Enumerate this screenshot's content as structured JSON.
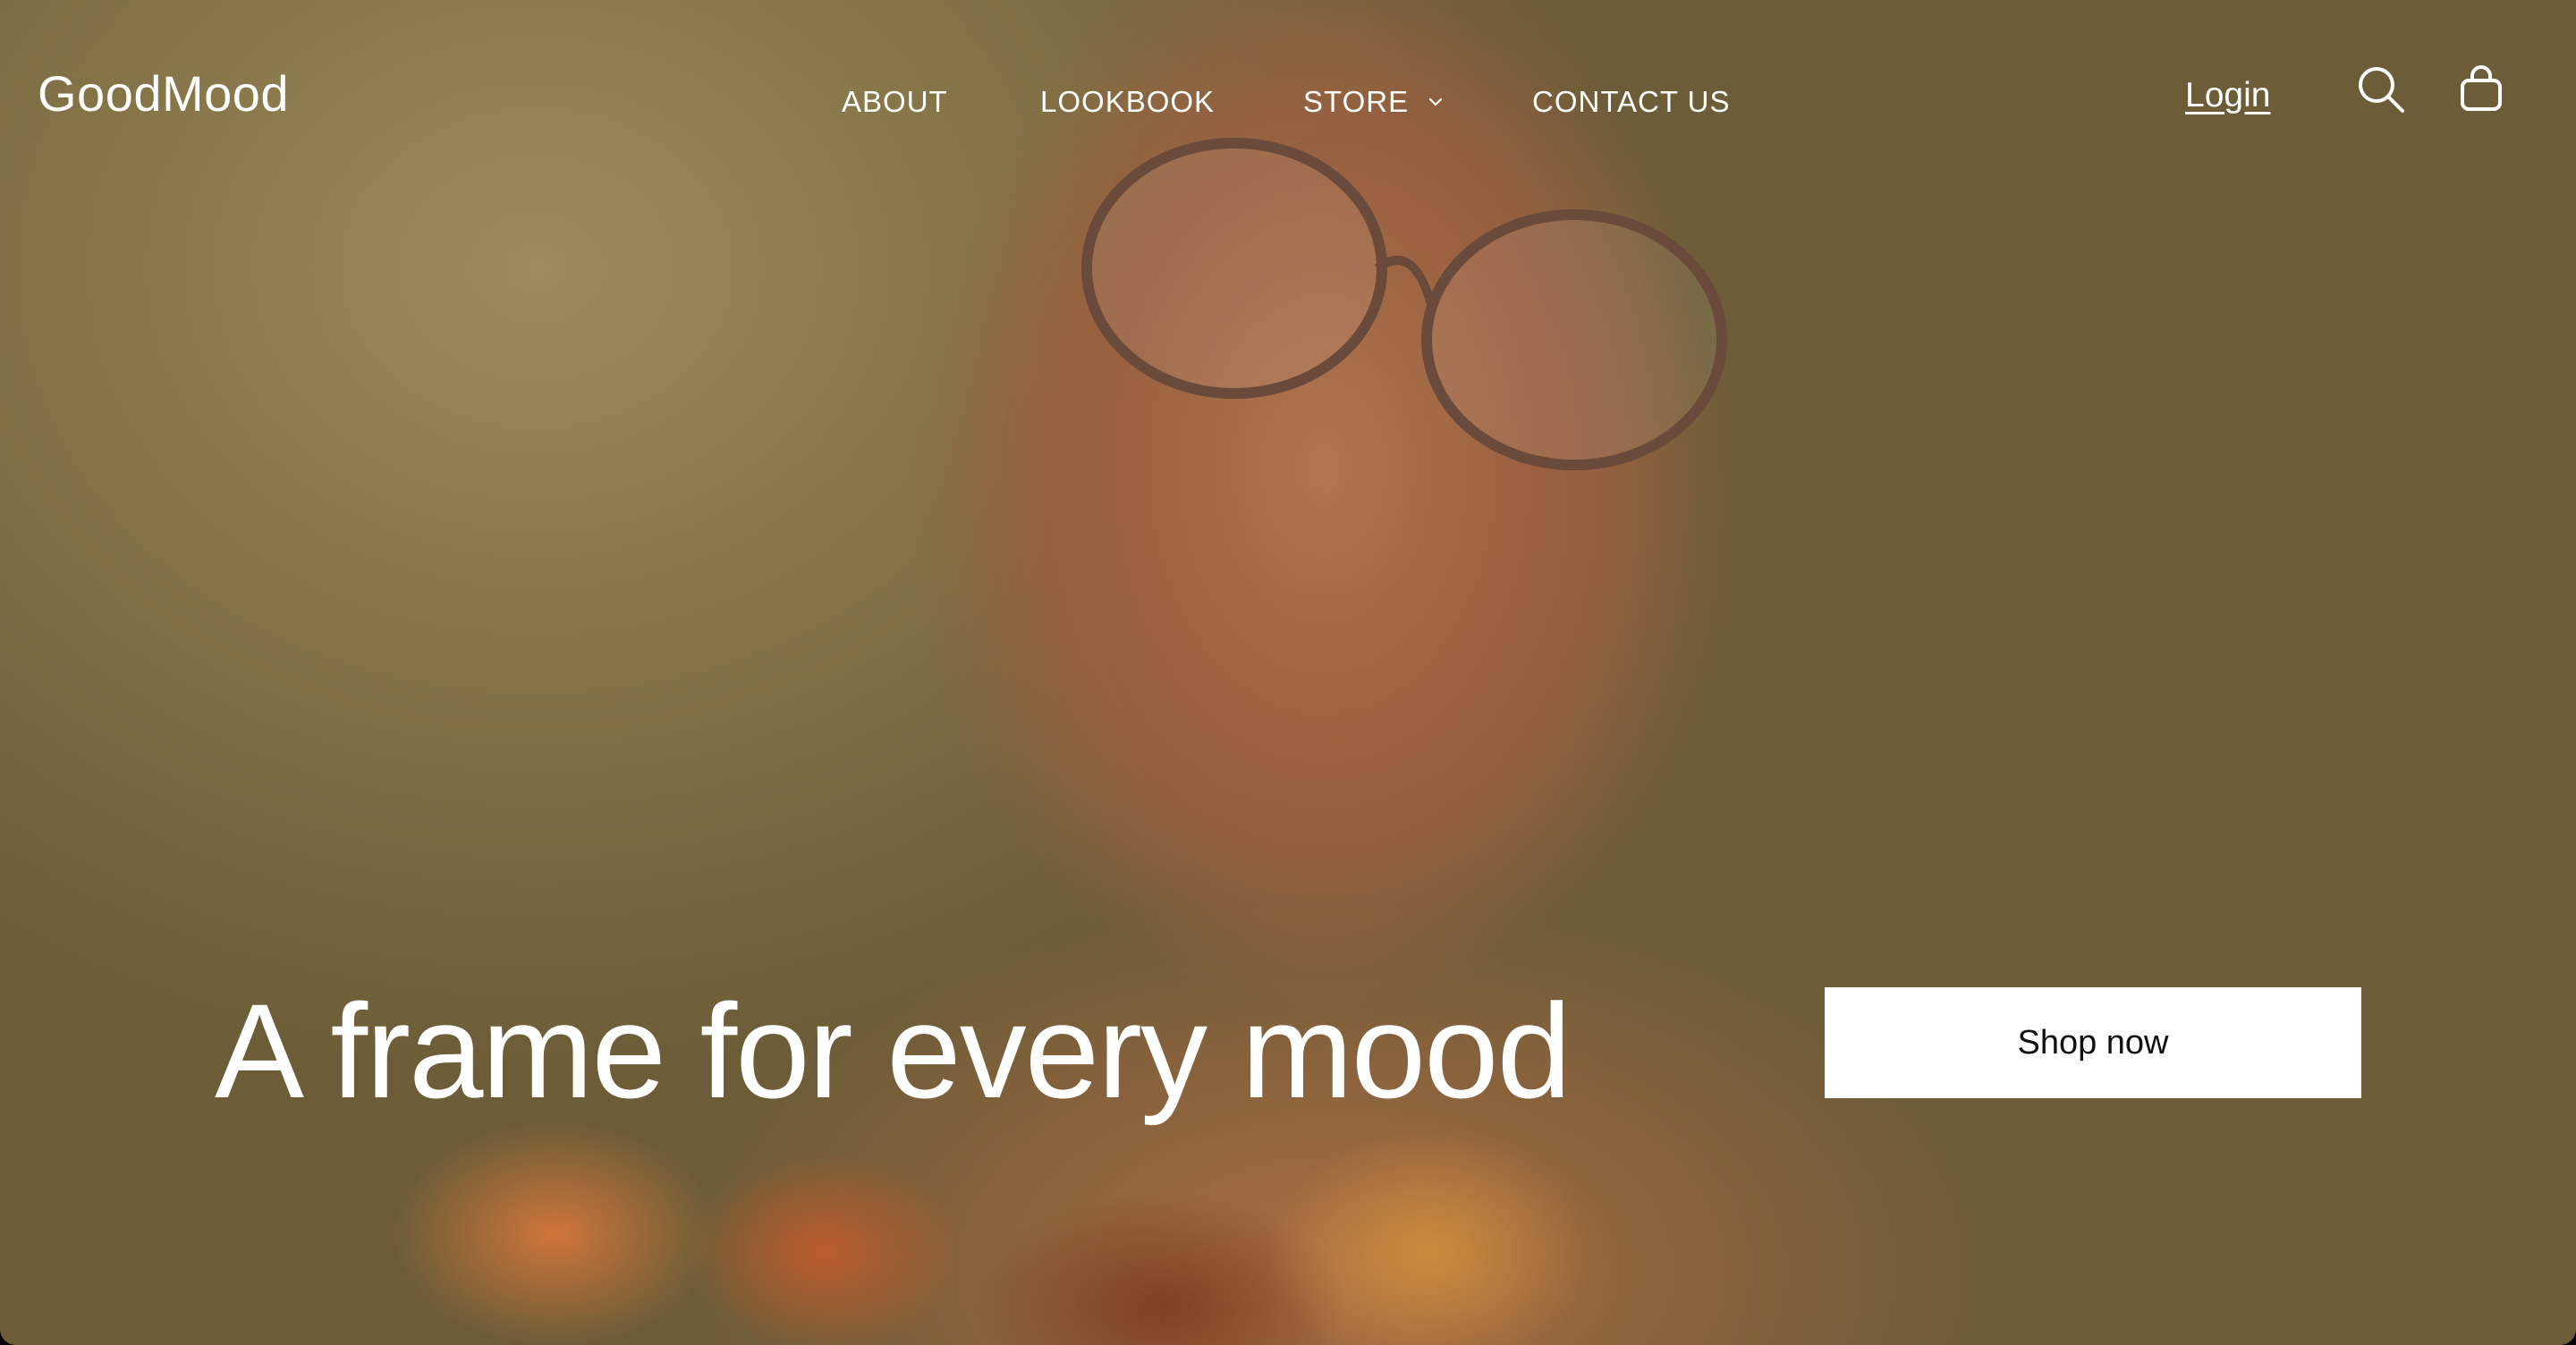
{
  "brand": {
    "logo_text": "GoodMood"
  },
  "nav": {
    "items": [
      {
        "label": "ABOUT"
      },
      {
        "label": "LOOKBOOK"
      },
      {
        "label": "STORE"
      },
      {
        "label": "CONTACT US"
      }
    ],
    "store_has_dropdown": true
  },
  "header_actions": {
    "login_label": "Login",
    "search_icon": "search-icon",
    "cart_icon": "shopping-bag-icon"
  },
  "hero": {
    "headline": "A frame for every mood",
    "cta_label": "Shop now",
    "image_subject": "woman wearing round glasses making a kissing face"
  },
  "colors": {
    "text": "#ffffff",
    "cta_background": "#ffffff",
    "cta_text": "#111111"
  }
}
